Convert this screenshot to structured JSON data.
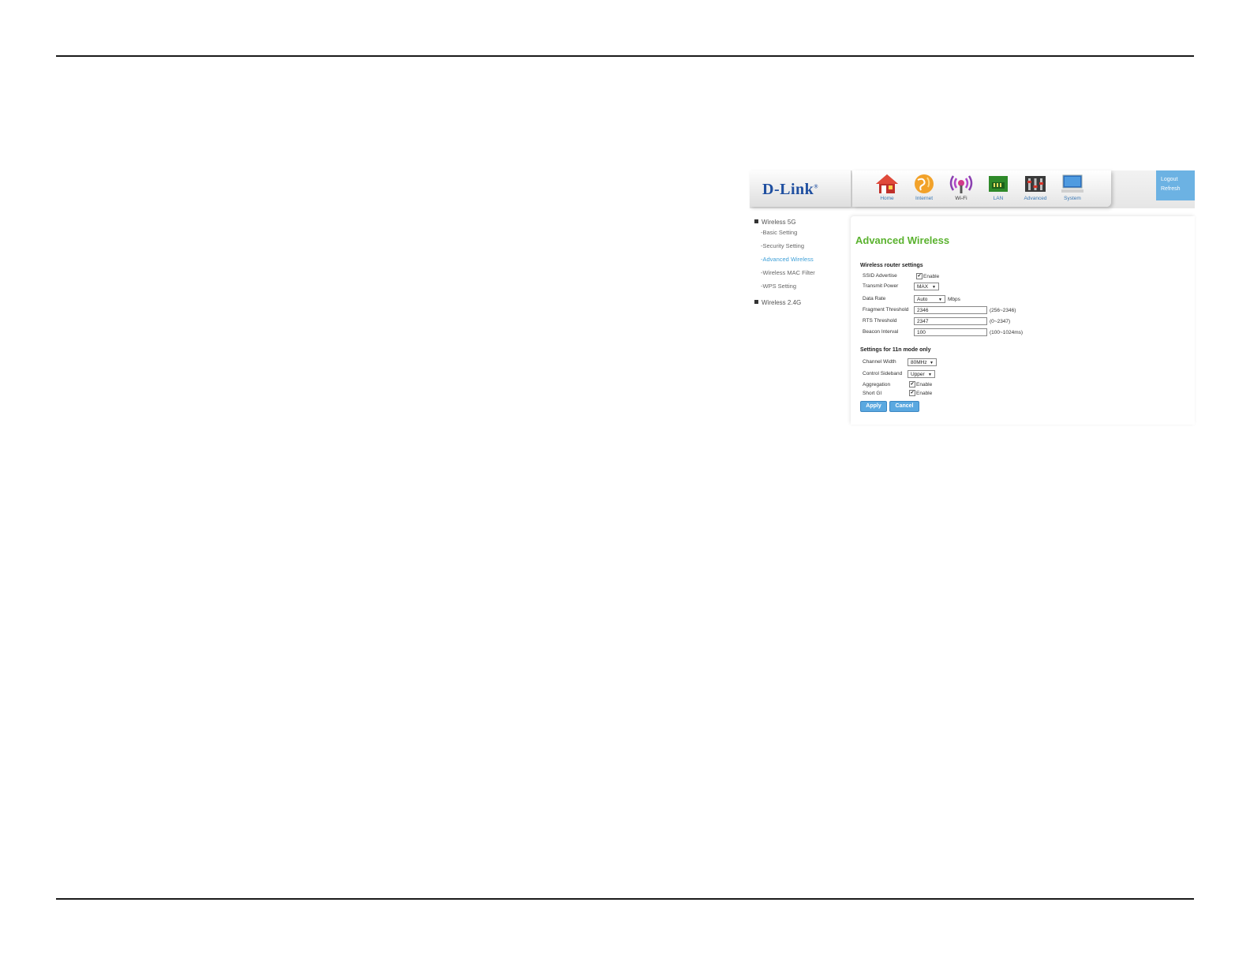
{
  "brand": {
    "logo_text": "D-Link",
    "logo_mark": "®"
  },
  "nav": [
    {
      "label": "Home",
      "icon": "home-icon",
      "active": false
    },
    {
      "label": "Internet",
      "icon": "globe-icon",
      "active": false
    },
    {
      "label": "Wi-Fi",
      "icon": "wifi-icon",
      "active": true
    },
    {
      "label": "LAN",
      "icon": "lan-icon",
      "active": false
    },
    {
      "label": "Advanced",
      "icon": "advanced-icon",
      "active": false
    },
    {
      "label": "System",
      "icon": "monitor-icon",
      "active": false
    }
  ],
  "session": {
    "logout": "Logout",
    "refresh": "Refresh"
  },
  "sidebar": {
    "group_5g": "Wireless 5G",
    "items": [
      "-Basic Setting",
      "-Security Setting",
      "-Advanced Wireless",
      "-Wireless MAC Filter",
      "-WPS Setting"
    ],
    "active_item": "-Advanced Wireless",
    "group_24g": "Wireless 2.4G"
  },
  "page": {
    "title": "Advanced Wireless",
    "router_section": "Wireless router settings",
    "ssid_advertise": {
      "label": "SSID Advertise",
      "checkbox_label": "Enable",
      "checked": true
    },
    "transmit_power": {
      "label": "Transmit Power",
      "value": "MAX"
    },
    "data_rate": {
      "label": "Data Rate",
      "value": "Auto",
      "unit": "Mbps"
    },
    "fragment_threshold": {
      "label": "Fragment Threshold",
      "value": "2346",
      "hint": "(256~2346)"
    },
    "rts_threshold": {
      "label": "RTS Threshold",
      "value": "2347",
      "hint": "(0~2347)"
    },
    "beacon_interval": {
      "label": "Beacon Interval",
      "value": "100",
      "hint": "(100~1024ms)"
    },
    "n_section": "Settings for 11n mode only",
    "channel_width": {
      "label": "Channel Width",
      "value": "80MHz"
    },
    "control_sideband": {
      "label": "Control Sideband",
      "value": "Upper"
    },
    "aggregation": {
      "label": "Aggregation",
      "checkbox_label": "Enable",
      "checked": true
    },
    "short_gi": {
      "label": "Short GI",
      "checkbox_label": "Enable",
      "checked": true
    },
    "apply": "Apply",
    "cancel": "Cancel"
  },
  "colors": {
    "accent_green": "#5ab22e",
    "link_blue": "#3fa0d8",
    "button_blue": "#5aa8e0",
    "logo_blue": "#1f4fa0"
  }
}
